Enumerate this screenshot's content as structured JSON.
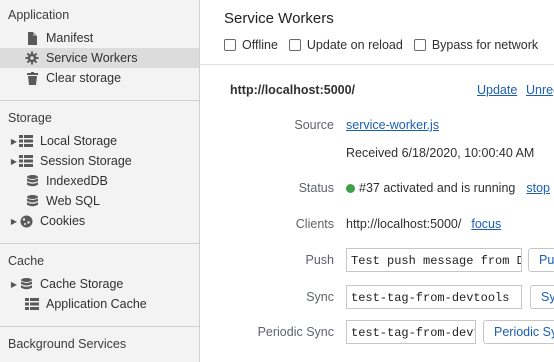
{
  "sidebar": {
    "application": {
      "header": "Application",
      "items": [
        {
          "label": "Manifest",
          "icon": "document-icon"
        },
        {
          "label": "Service Workers",
          "icon": "gear-icon"
        },
        {
          "label": "Clear storage",
          "icon": "trash-icon"
        }
      ]
    },
    "storage": {
      "header": "Storage",
      "items": [
        {
          "label": "Local Storage",
          "icon": "grid-icon"
        },
        {
          "label": "Session Storage",
          "icon": "grid-icon"
        },
        {
          "label": "IndexedDB",
          "icon": "database-icon"
        },
        {
          "label": "Web SQL",
          "icon": "database-icon"
        },
        {
          "label": "Cookies",
          "icon": "cookie-icon"
        }
      ]
    },
    "cache": {
      "header": "Cache",
      "items": [
        {
          "label": "Cache Storage",
          "icon": "database-icon"
        },
        {
          "label": "Application Cache",
          "icon": "grid-icon"
        }
      ]
    },
    "background": {
      "header": "Background Services"
    }
  },
  "main": {
    "title": "Service Workers",
    "options": {
      "offline": "Offline",
      "update_on_reload": "Update on reload",
      "bypass_for_network": "Bypass for network"
    },
    "worker": {
      "origin": "http://localhost:5000/",
      "update_link": "Update",
      "unregister_link": "Unregister",
      "source_label": "Source",
      "source_file": "service-worker.js",
      "received": "Received 6/18/2020, 10:00:40 AM",
      "status_label": "Status",
      "status_text": "#37 activated and is running",
      "status_color": "#3fa04a",
      "stop_link": "stop",
      "clients_label": "Clients",
      "client_url": "http://localhost:5000/",
      "focus_link": "focus",
      "push_label": "Push",
      "push_value": "Test push message from DevTools.",
      "push_button": "Push",
      "sync_label": "Sync",
      "sync_value": "test-tag-from-devtools",
      "sync_button": "Sync",
      "periodic_sync_label": "Periodic Sync",
      "periodic_sync_value": "test-tag-from-devtools",
      "periodic_sync_button": "Periodic Sync"
    }
  }
}
